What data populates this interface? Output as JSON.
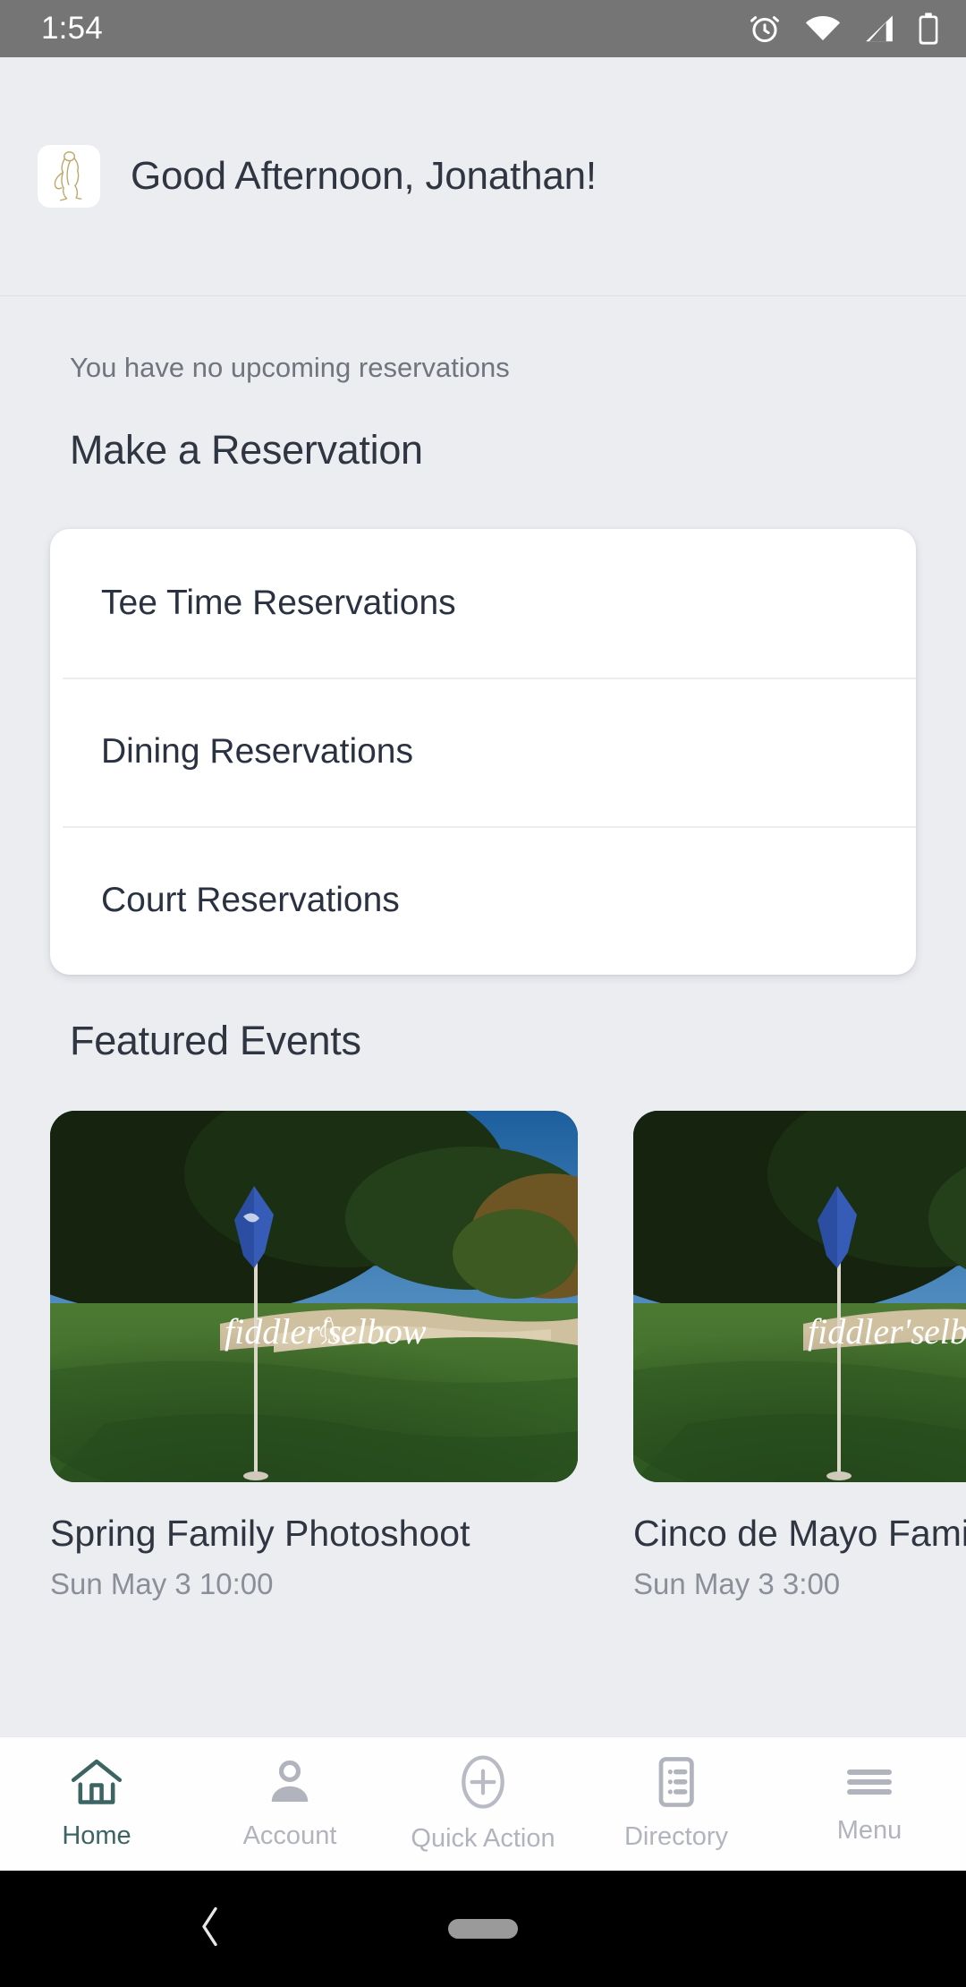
{
  "status_bar": {
    "time": "1:54",
    "icons": [
      "alarm-icon",
      "wifi-icon",
      "signal-icon",
      "battery-icon"
    ]
  },
  "header": {
    "logo_icon": "golfer-logo-icon",
    "greeting": "Good Afternoon, Jonathan!"
  },
  "main": {
    "no_reservations_text": "You have no upcoming reservations",
    "make_reservation_title": "Make a Reservation",
    "reservation_options": [
      {
        "label": "Tee Time Reservations"
      },
      {
        "label": "Dining Reservations"
      },
      {
        "label": "Court Reservations"
      }
    ],
    "featured_events_title": "Featured Events",
    "events": [
      {
        "title": "Spring Family Photoshoot",
        "date": "Sun May 3 10:00",
        "image_alt": "golf-course-flagstick-photo",
        "image_logo_text": "fiddler's elbow"
      },
      {
        "title": "Cinco de Mayo Family Night",
        "date": "Sun May 3 3:00",
        "image_alt": "golf-course-flagstick-photo",
        "image_logo_text": "fiddler's elbow"
      }
    ]
  },
  "bottom_nav": {
    "items": [
      {
        "label": "Home",
        "icon": "home-icon",
        "active": true
      },
      {
        "label": "Account",
        "icon": "person-icon",
        "active": false
      },
      {
        "label": "Quick Action",
        "icon": "plus-circle-icon",
        "active": false
      },
      {
        "label": "Directory",
        "icon": "list-icon",
        "active": false
      },
      {
        "label": "Menu",
        "icon": "hamburger-icon",
        "active": false
      }
    ]
  },
  "android_nav": {
    "back_icon": "back-chevron-icon",
    "home_pill": "home-pill-indicator"
  },
  "colors": {
    "background": "#ebedf1",
    "card": "#ffffff",
    "text_primary": "#2f3642",
    "text_muted": "#70757e",
    "accent_teal": "#3c6462",
    "inactive_gray": "#b1b4bd",
    "status_bar": "#757575",
    "logo_gold": "#bda86a",
    "flag_blue": "#2b4ea2"
  }
}
